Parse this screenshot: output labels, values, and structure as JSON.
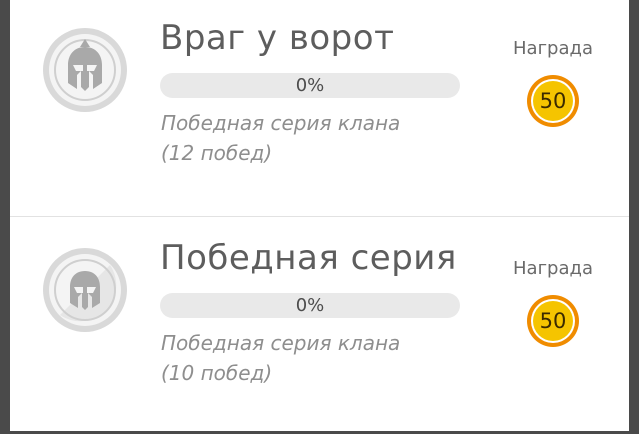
{
  "achievements": [
    {
      "title": "Враг у ворот",
      "progress_text": "0%",
      "progress": 0,
      "description_line1": "Победная серия клана",
      "description_line2": "(12 побед)",
      "reward_label": "Награда",
      "reward_value": "50",
      "icon": "spartan-helmet-icon"
    },
    {
      "title": "Победная серия",
      "progress_text": "0%",
      "progress": 0,
      "description_line1": "Победная серия клана",
      "description_line2": "(10 побед)",
      "reward_label": "Награда",
      "reward_value": "50",
      "icon": "spartan-helmet-icon"
    }
  ],
  "colors": {
    "title": "#5d5d5d",
    "description": "#8e8e8e",
    "progress_track": "#e9e9e9",
    "coin_gold": "#f5c400",
    "coin_orange": "#f08c00",
    "badge_gray": "#b8b8b8"
  }
}
